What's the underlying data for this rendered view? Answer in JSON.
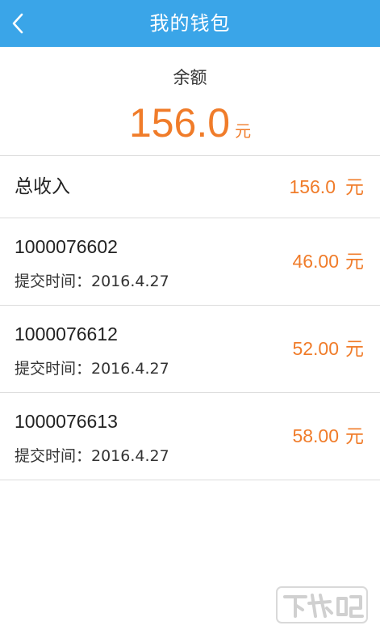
{
  "header": {
    "title": "我的钱包",
    "back_icon": "chevron-left-icon",
    "background_color": "#3aa5e8"
  },
  "balance": {
    "label": "余额",
    "amount": "156.0",
    "unit": "元"
  },
  "total": {
    "label": "总收入",
    "amount": "156.0",
    "unit": "元"
  },
  "records": [
    {
      "id": "1000076602",
      "time": "提交时间：2016.4.27",
      "amount": "46.00",
      "unit": "元"
    },
    {
      "id": "1000076612",
      "time": "提交时间：2016.4.27",
      "amount": "52.00",
      "unit": "元"
    },
    {
      "id": "1000076613",
      "time": "提交时间：2016.4.27",
      "amount": "58.00",
      "unit": "元"
    }
  ],
  "watermark": {
    "text": "下载吧"
  },
  "colors": {
    "accent": "#f07c2a",
    "header": "#3aa5e8",
    "divider": "#dcdcdc"
  }
}
